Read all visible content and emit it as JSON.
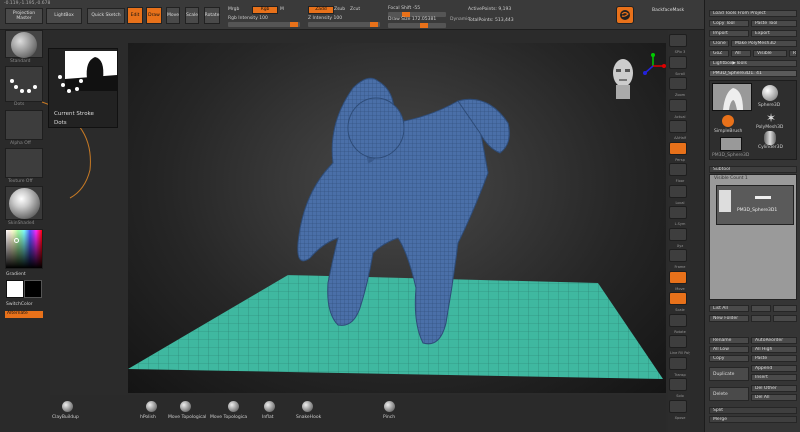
{
  "top": {
    "coords": "-0.119,-1.195,-0.678",
    "projection_master": "Projection Master",
    "lightbox": "LightBox",
    "quick_sketch": "Quick Sketch",
    "edit": "Edit",
    "draw": "Draw",
    "move": "Move",
    "scale": "Scale",
    "rotate": "Rotate",
    "mrgb": "Mrgb",
    "rgb": "Rgb",
    "m": "M",
    "zadd": "Zadd",
    "zsub": "Zsub",
    "zcut": "Zcut",
    "rgb_intensity": "Rgb Intensity 100",
    "z_intensity": "Z Intensity 100",
    "focal_shift": "Focal Shift -55",
    "draw_size": "Draw Size 172.05381",
    "dynamic": "Dynamic",
    "active_points": "ActivePoints: 9,193",
    "total_points": "TotalPoints: 513,443",
    "backface_mask": "BackfaceMask"
  },
  "left": {
    "brush_label": "Standard",
    "stroke_label": "Dots",
    "alpha_label": "Alpha Off",
    "texture_label": "Texture Off",
    "material_label": "SkinShade4",
    "gradient": "Gradient",
    "switch_color": "SwitchColor",
    "alternate": "Alternate"
  },
  "tooltip": {
    "line1": "Current Stroke",
    "line2": "Dots"
  },
  "right_tray": [
    "SPix 3",
    "Scroll",
    "Zoom",
    "Actual",
    "AAHalf",
    "Persp",
    "Floor",
    "Local",
    "L.Sym",
    "Xyz",
    "Frame",
    "Move",
    "Scale",
    "Rotate",
    "Line Fill PolyF",
    "Transp",
    "Solo",
    "Xpose"
  ],
  "panel": {
    "load_tools": "Load Tools From Project",
    "copy_tool": "Copy Tool",
    "paste_tool": "Paste Tool",
    "import": "Import",
    "export": "Export",
    "clone": "Clone",
    "make_polymesh": "Make PolyMesh3D",
    "goz": "GoZ",
    "all": "All",
    "visible": "Visible",
    "r": "R",
    "lightbox_tools": "Lightbox▶Tools",
    "current_tool": "PM3D_Sphere3D1. 41",
    "tools": [
      "PM3D_Sphere3D1",
      "Sphere3D",
      "SimpleBrush",
      "PolyMesh3D",
      "Cylinder3D",
      "PM3D_Sphere3D"
    ],
    "subtool": "Subtool",
    "visible_count": "Visible Count 1",
    "subtool_item": "PM3D_Sphere3D1",
    "list_all": "List All",
    "new_folder": "New Folder",
    "rename": "Rename",
    "autoreorder": "AutoReorder",
    "all_low": "All Low",
    "all_high": "All High",
    "copy": "Copy",
    "paste": "Paste",
    "duplicate": "Duplicate",
    "append": "Append",
    "insert": "Insert",
    "delete": "Delete",
    "del_other": "Del Other",
    "del_all": "Del All",
    "split": "Split",
    "merge": "Merge"
  },
  "bottom": {
    "brushes": [
      "ClayBuildup",
      "hPolish",
      "Move Topological",
      "Move Topologica",
      "Inflat",
      "SnakeHook",
      "Pinch"
    ]
  },
  "colors": {
    "accent": "#e8711a",
    "mesh": "#4a6fa8",
    "floor": "#3fb8a0"
  }
}
